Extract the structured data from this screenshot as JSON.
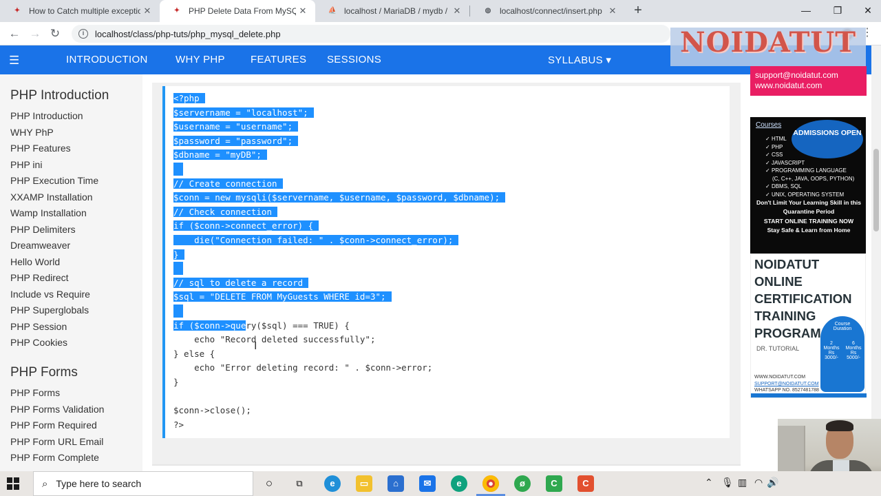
{
  "tabs": [
    {
      "title": "How to Catch multiple exception",
      "favicon": "favicon-a",
      "active": false
    },
    {
      "title": "PHP Delete Data From MySQL",
      "favicon": "favicon-b",
      "active": true
    },
    {
      "title": "localhost / MariaDB / mydb / My",
      "favicon": "phpmyadmin-icon",
      "active": false
    },
    {
      "title": "localhost/connect/insert.php",
      "favicon": "globe-icon",
      "active": false
    }
  ],
  "address": {
    "url": "localhost/class/php-tuts/php_mysql_delete.php"
  },
  "site_nav": {
    "links": [
      "INTRODUCTION",
      "WHY PHP",
      "FEATURES",
      "SESSIONS"
    ],
    "syllabus": "SYLLABUS ▾",
    "logo": "NOIDATUT"
  },
  "sidebar": {
    "section1_title": "PHP Introduction",
    "section1_items": [
      "PHP Introduction",
      "WHY PhP",
      "PHP Features",
      "PHP ini",
      "PHP Execution Time",
      "XXAMP Installation",
      "Wamp Installation",
      "PHP Delimiters",
      "Dreamweaver",
      "Hello World",
      "PHP Redirect",
      "Include vs Require",
      "PHP Superglobals",
      "PHP Session",
      "PHP Cookies"
    ],
    "section2_title": "PHP Forms",
    "section2_items": [
      "PHP Forms",
      "PHP Forms Validation",
      "PHP Form Required",
      "PHP Form URL Email",
      "PHP Form Complete"
    ]
  },
  "code": {
    "lines": [
      {
        "text": "<?php",
        "selected": true
      },
      {
        "text": "$servername = \"localhost\";",
        "selected": true
      },
      {
        "text": "$username = \"username\";",
        "selected": true
      },
      {
        "text": "$password = \"password\";",
        "selected": true
      },
      {
        "text": "$dbname = \"myDB\";",
        "selected": true
      },
      {
        "text": "",
        "selected": true
      },
      {
        "text": "// Create connection",
        "selected": true
      },
      {
        "text": "$conn = new mysqli($servername, $username, $password, $dbname);",
        "selected": true
      },
      {
        "text": "// Check connection",
        "selected": true
      },
      {
        "text": "if ($conn->connect_error) {",
        "selected": true
      },
      {
        "text": "    die(\"Connection failed: \" . $conn->connect_error);",
        "selected": true
      },
      {
        "text": "}",
        "selected": true
      },
      {
        "text": "",
        "selected": true
      },
      {
        "text": "// sql to delete a record",
        "selected": true
      },
      {
        "text": "$sql = \"DELETE FROM MyGuests WHERE id=3\";",
        "selected": true
      },
      {
        "text": "",
        "selected": true
      },
      {
        "text": "if ($conn->query($sql) === TRUE) {",
        "selected_prefix": "if ($conn->que",
        "rest": "ry($sql) === TRUE) {"
      },
      {
        "text": "    echo \"Record deleted successfully\";",
        "selected": false
      },
      {
        "text": "} else {",
        "selected": false
      },
      {
        "text": "    echo \"Error deleting record: \" . $conn->error;",
        "selected": false
      },
      {
        "text": "}",
        "selected": false
      },
      {
        "text": "",
        "selected": false
      },
      {
        "text": "$conn->close();",
        "selected": false
      },
      {
        "text": "?>",
        "selected": false
      }
    ]
  },
  "ads": {
    "contact_email": "support@noidatut.com",
    "contact_web": "www.noidatut.com",
    "courses_label": "Courses",
    "admissions": "ADMISSIONS OPEN",
    "course_list": [
      "HTML",
      "PHP",
      "CSS",
      "JAVASCRIPT",
      "PROGRAMMING LANGUAGE",
      "(C, C++, JAVA, OOPS, PYTHON)",
      "DBMS, SQL",
      "UNIX, OPERATING SYSTEM"
    ],
    "tagline1": "Don't Limit Your Learning Skill in this Quarantine Period",
    "tagline2": "START ONLINE TRAINING NOW",
    "tagline3": "Stay Safe & Learn from Home",
    "cert_title": "NOIDATUT ONLINE CERTIFICATION TRAINING PROGRAM",
    "cert_by": "DR. TUTORIAL",
    "course_duration": "Course Duration",
    "dur1": "2 Months Rs 3000/-",
    "dur2": "6 Months Rs 5000/-",
    "footer_web": "WWW.NOIDATUT.COM",
    "footer_mail": "SUPPORT@NOIDATUT.COM",
    "footer_phone": "WHATSAPP NO. 8527481788"
  },
  "taskbar": {
    "search_placeholder": "Type here to search"
  },
  "colors": {
    "nav_blue": "#1a73e8",
    "selection": "#1e90ff",
    "code_border": "#2196f3",
    "ad_pink": "#e91e63",
    "logo_red": "#d2554a"
  }
}
